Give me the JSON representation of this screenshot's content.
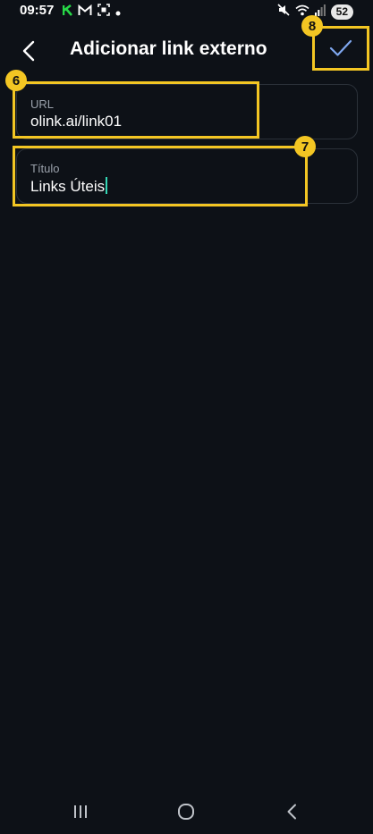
{
  "status_bar": {
    "time": "09:57",
    "battery": "52",
    "left_icons": [
      "app-k-icon",
      "gmail-icon",
      "screenshot-icon",
      "dot-icon"
    ],
    "right_icons": [
      "mute-icon",
      "wifi-icon",
      "signal-icon"
    ]
  },
  "header": {
    "title": "Adicionar link externo",
    "back_icon": "chevron-left-icon",
    "confirm_icon": "checkmark-icon"
  },
  "form": {
    "url": {
      "label": "URL",
      "value": "olink.ai/link01"
    },
    "title": {
      "label": "Título",
      "value": "Links Úteis"
    }
  },
  "annotations": {
    "badge_url": "6",
    "badge_title": "7",
    "badge_confirm": "8",
    "highlight_color": "#f3c623"
  },
  "colors": {
    "background": "#0d1117",
    "field_border": "#2b3139",
    "confirm_check": "#7fa7ef",
    "cursor": "#34d6b5"
  },
  "nav_bar": {
    "icons": [
      "recents-icon",
      "home-icon",
      "back-icon"
    ]
  }
}
